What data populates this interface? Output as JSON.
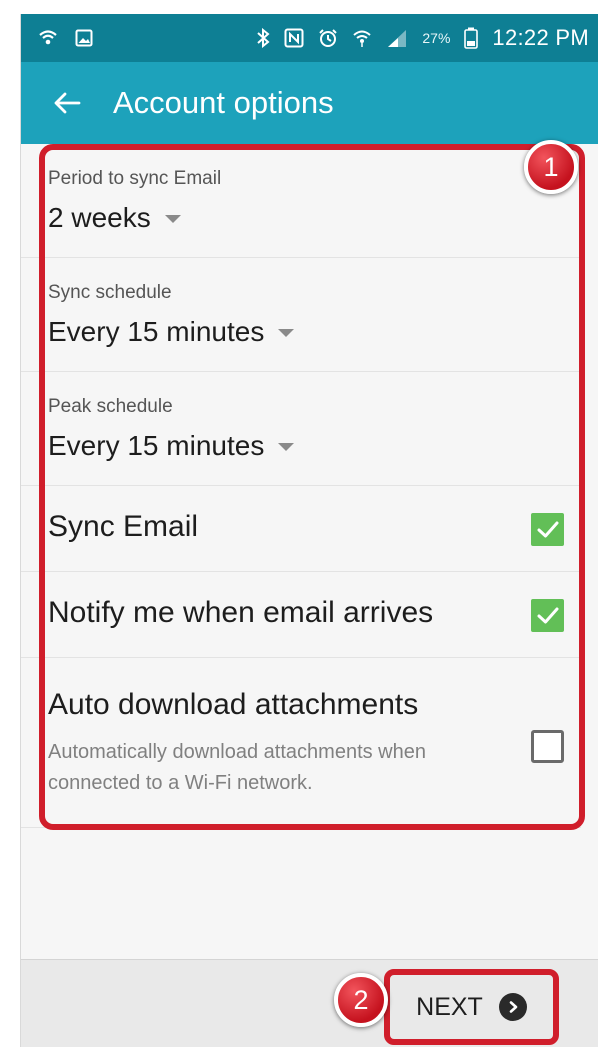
{
  "status_bar": {
    "battery_percent": "27%",
    "time": "12:22 PM",
    "left_icons": [
      "wifi-calling-icon",
      "gallery-icon"
    ],
    "right_icons": [
      "bluetooth-icon",
      "nfc-icon",
      "alarm-icon",
      "wifi-icon",
      "signal-icon",
      "battery-icon"
    ]
  },
  "app_bar": {
    "title": "Account options",
    "back_icon": "arrow-left-icon"
  },
  "settings": {
    "sync_period": {
      "label": "Period to sync Email",
      "value": "2 weeks"
    },
    "sync_schedule": {
      "label": "Sync schedule",
      "value": "Every 15 minutes"
    },
    "peak_schedule": {
      "label": "Peak schedule",
      "value": "Every 15 minutes"
    },
    "sync_email": {
      "label": "Sync Email",
      "checked": true
    },
    "notify": {
      "label": "Notify me when email arrives",
      "checked": true
    },
    "auto_download": {
      "label": "Auto download attachments",
      "description": "Automatically download attachments when connected to a Wi-Fi network.",
      "checked": false
    }
  },
  "annotations": {
    "step1": "1",
    "step2": "2"
  },
  "footer": {
    "next_label": "NEXT",
    "next_icon": "chevron-right-circle-icon"
  },
  "colors": {
    "status_bar": "#0e7f94",
    "app_bar": "#1da2bb",
    "checkbox_on": "#62bf57",
    "annotation_red": "#d01e2b"
  }
}
